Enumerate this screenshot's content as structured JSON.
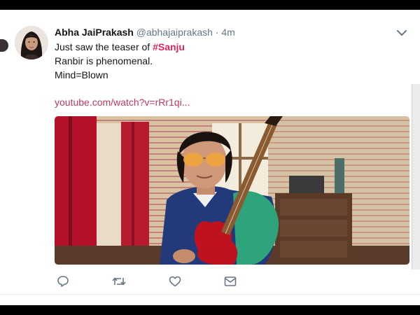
{
  "tweet": {
    "author_name": "Abha JaiPrakash",
    "handle": "@abhajaiprakash",
    "separator": "·",
    "time": "4m",
    "text_prefix": "Just saw the teaser of ",
    "hashtag": "#Sanju",
    "line2": "Ranbir is phenomenal.",
    "line3": "Mind=Blown",
    "link": "youtube.com/watch?v=rRr1qi..."
  },
  "actions": [
    {
      "name": "reply",
      "icon": "reply-icon"
    },
    {
      "name": "retweet",
      "icon": "retweet-icon"
    },
    {
      "name": "like",
      "icon": "heart-icon"
    },
    {
      "name": "direct-message",
      "icon": "mail-icon"
    }
  ],
  "colors": {
    "hashtag": "#e0245e",
    "link": "#c0395f",
    "icon": "#657786",
    "text": "#14171a"
  }
}
